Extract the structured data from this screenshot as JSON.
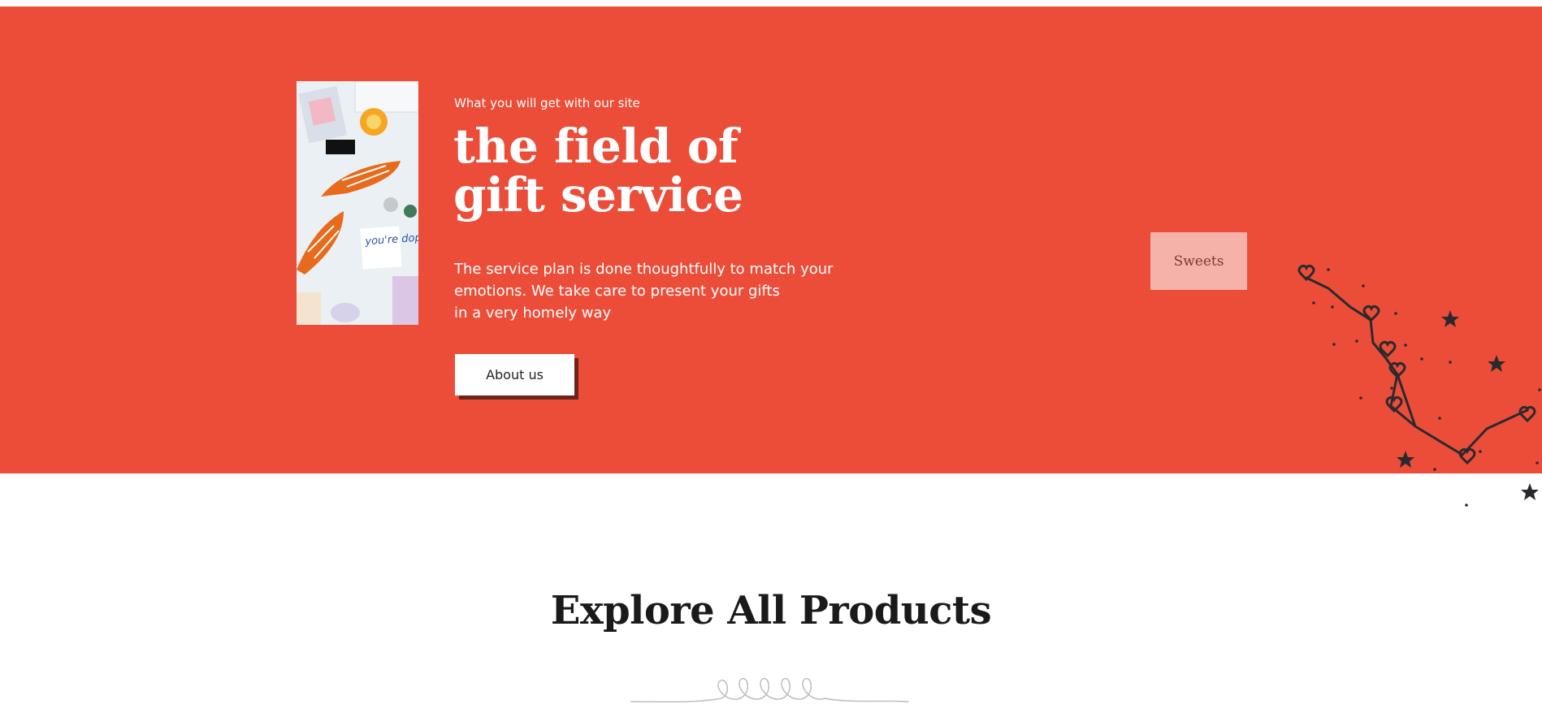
{
  "hero": {
    "eyebrow": "What you will get with our site",
    "headline_lines": [
      "the field of",
      "gift service"
    ],
    "description_lines": [
      "The service plan is done thoughtfully to match your",
      "emotions. We take care to present your gifts",
      "in a very homely way"
    ],
    "about_button": "About us",
    "photo_text": "you're dope.",
    "background_color": "#ec4d39"
  },
  "sweets_button": "Sweets",
  "products": {
    "title": "Explore All Products"
  }
}
